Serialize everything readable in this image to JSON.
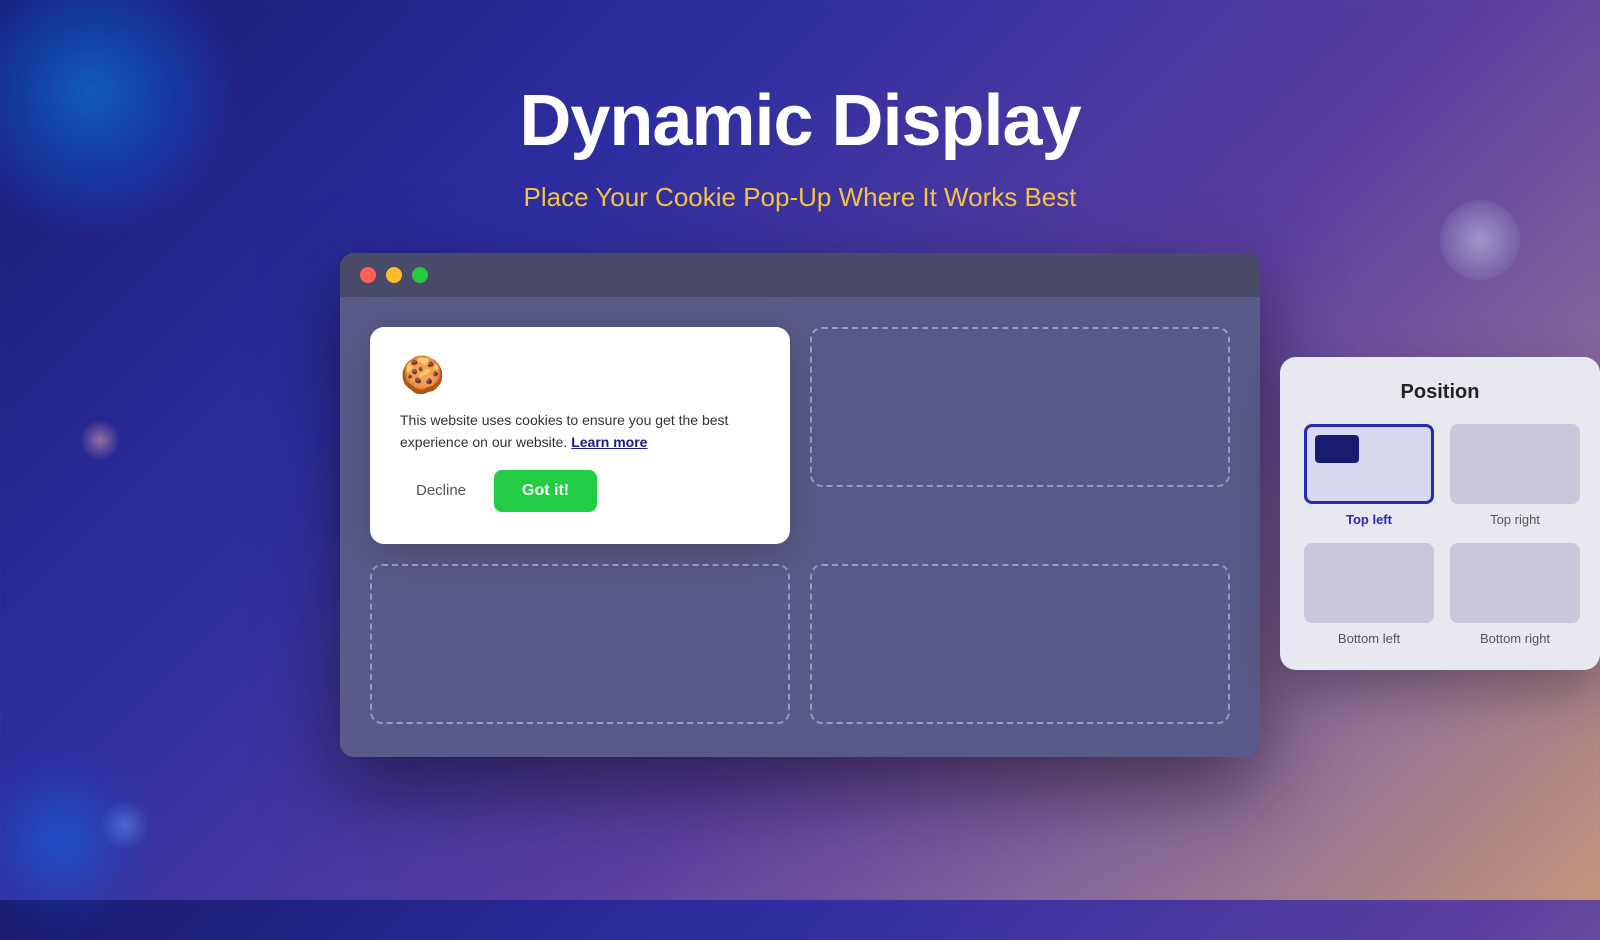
{
  "page": {
    "title": "Dynamic Display",
    "subtitle": "Place Your Cookie Pop-Up Where It Works Best"
  },
  "browser": {
    "traffic_lights": [
      "red",
      "yellow",
      "green"
    ]
  },
  "cookie_popup": {
    "icon": "🍪",
    "text": "This website uses cookies to ensure you get the best experience on our website.",
    "learn_more_label": "Learn more",
    "decline_label": "Decline",
    "accept_label": "Got it!"
  },
  "position_panel": {
    "title": "Position",
    "options": [
      {
        "id": "top-left",
        "label": "Top left",
        "selected": true
      },
      {
        "id": "top-right",
        "label": "Top right",
        "selected": false
      },
      {
        "id": "bottom-left",
        "label": "Bottom left",
        "selected": false
      },
      {
        "id": "bottom-right",
        "label": "Bottom right",
        "selected": false
      }
    ]
  }
}
